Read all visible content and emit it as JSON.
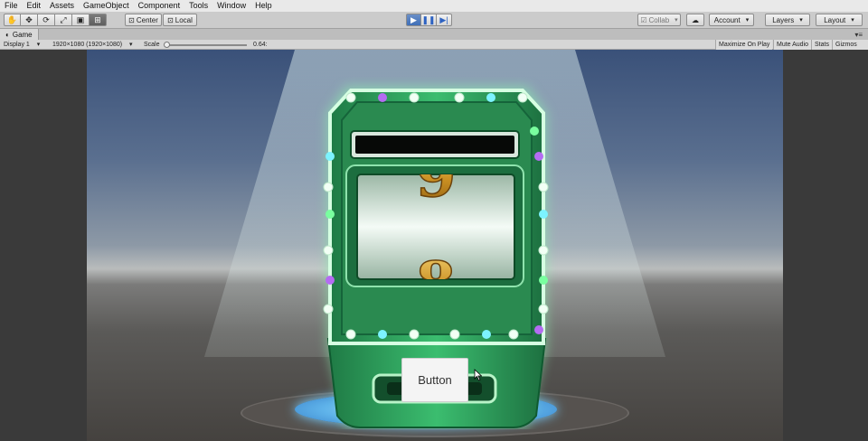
{
  "menu": [
    "File",
    "Edit",
    "Assets",
    "GameObject",
    "Component",
    "Tools",
    "Window",
    "Help"
  ],
  "toolbar": {
    "tools": [
      "hand-icon",
      "move-icon",
      "rotate-icon",
      "scale-icon",
      "rect-icon",
      "transform-icon"
    ],
    "pivot_label": "Center",
    "space_label": "Local",
    "collab_label": "Collab",
    "account_label": "Account",
    "layers_label": "Layers",
    "layout_label": "Layout"
  },
  "game_tab": {
    "title": "Game",
    "display": "Display 1",
    "resolution": "1920×1080 (1920×1080)",
    "scale_label": "Scale",
    "scale_value": "0.64:",
    "options": [
      "Maximize On Play",
      "Mute Audio",
      "Stats",
      "Gizmos"
    ]
  },
  "scene": {
    "reel_digit": "9",
    "button_label": "Button"
  },
  "colors": {
    "machine_green": "#2f9a5c",
    "platform_glow": "#5fb3ea",
    "digit_gold": "#d8a02a"
  }
}
